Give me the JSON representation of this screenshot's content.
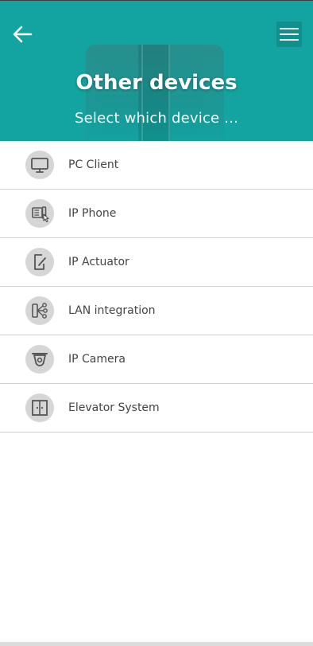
{
  "header": {
    "title": "Other devices",
    "subtitle": "Select which device ...",
    "color": "#13a3a0"
  },
  "devices": [
    {
      "label": "PC Client",
      "icon": "monitor-icon"
    },
    {
      "label": "IP Phone",
      "icon": "ip-phone-icon"
    },
    {
      "label": "IP Actuator",
      "icon": "actuator-icon"
    },
    {
      "label": "LAN integration",
      "icon": "lan-share-icon"
    },
    {
      "label": "IP Camera",
      "icon": "camera-icon"
    },
    {
      "label": "Elevator System",
      "icon": "elevator-icon"
    }
  ]
}
